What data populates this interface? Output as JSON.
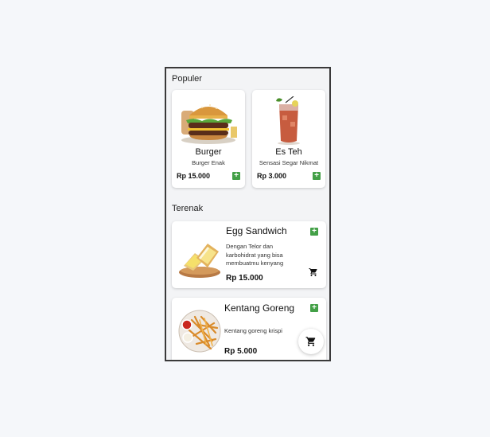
{
  "sections": {
    "popular_title": "Populer",
    "terenak_title": "Terenak"
  },
  "popular": [
    {
      "name": "Burger",
      "desc": "Burger Enak",
      "price": "Rp 15.000",
      "image": "burger-image"
    },
    {
      "name": "Es Teh",
      "desc": "Sensasi Segar Nikmat",
      "price": "Rp 3.000",
      "image": "iced-tea-image"
    }
  ],
  "terenak": [
    {
      "name": "Egg Sandwich",
      "desc": "Dengan Telor dan karbohidrat yang bisa membuatmu kenyang",
      "price": "Rp 15.000",
      "image": "egg-sandwich-image"
    },
    {
      "name": "Kentang Goreng",
      "desc": "Kentang goreng krispi",
      "price": "Rp 5.000",
      "image": "french-fries-image"
    }
  ],
  "icons": {
    "add": "plus-icon",
    "cart": "cart-icon"
  },
  "colors": {
    "add_button": "#43a047",
    "background": "#f3f4f6"
  }
}
